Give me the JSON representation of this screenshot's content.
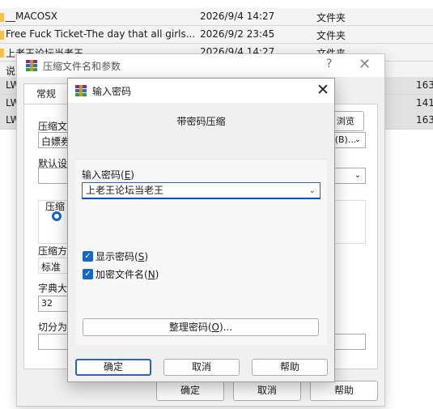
{
  "explorer": {
    "rows": [
      {
        "name": "__MACOSX",
        "date": "2026/9/4 14:27",
        "type": "文件夹",
        "size": ""
      },
      {
        "name": "Free Fuck Ticket-The day that all girls...",
        "date": "2026/9/2 23:45",
        "type": "文件夹",
        "size": ""
      },
      {
        "name": "上老王论坛当老王",
        "date": "2026/9/4 14:27",
        "type": "文件夹",
        "size": ""
      },
      {
        "name": "说",
        "date": "",
        "type": "",
        "size": ""
      },
      {
        "name": "LW",
        "date": "",
        "type": "",
        "size": "163,"
      },
      {
        "name": "LW",
        "date": "",
        "type": "",
        "size": "141,"
      },
      {
        "name": "LW",
        "date": "",
        "type": "",
        "size": "163,"
      }
    ]
  },
  "archive_dialog": {
    "title": "压缩文件名和参数",
    "help": "?",
    "close": "✕",
    "tab_general": "常规",
    "archive_name_label": "压缩文",
    "archive_name_value": "白嫖券",
    "browse_button": "浏览(B)...",
    "default_profile_label": "默认设",
    "format_group_label": "压缩",
    "method_label": "压缩方",
    "method_value": "标准",
    "dict_label": "字典大",
    "dict_value": "32",
    "split_label": "切分为",
    "ok": "确定",
    "cancel": "取消",
    "help_btn": "帮助"
  },
  "password_dialog": {
    "title": "输入密码",
    "close": "✕",
    "heading": "带密码压缩",
    "password_label_pre": "输入密码(",
    "password_label_key": "E",
    "password_label_post": ")",
    "password_value": "上老王论坛当老王",
    "show_password_pre": "显示密码(",
    "show_password_key": "S",
    "show_password_post": ")",
    "encrypt_names_pre": "加密文件名(",
    "encrypt_names_key": "N",
    "encrypt_names_post": ")",
    "organize_pre": "整理密码(",
    "organize_key": "O",
    "organize_post": ")...",
    "ok": "确定",
    "cancel": "取消",
    "help": "帮助"
  },
  "colors": {
    "accent": "#1667c5",
    "folder": "#f2c14e",
    "row_selected": "#e1e1e1"
  }
}
